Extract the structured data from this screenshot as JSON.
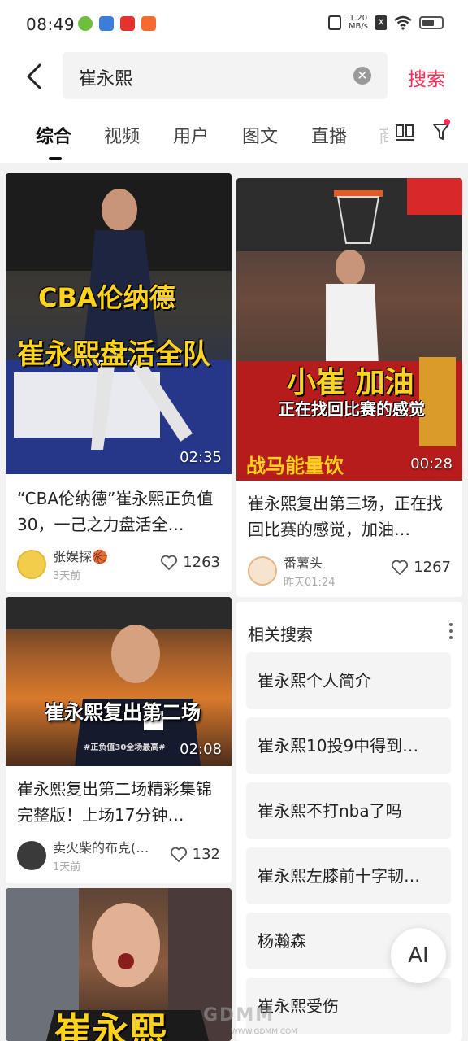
{
  "status_bar": {
    "time": "08:49",
    "net_speed_top": "1.20",
    "net_speed_bottom": "MB/s",
    "x_label": "X"
  },
  "search": {
    "query": "崔永熙",
    "button_label": "搜索"
  },
  "tabs": [
    "综合",
    "视频",
    "用户",
    "图文",
    "直播"
  ],
  "tab_overflow": "商",
  "cards": [
    {
      "thumb_text_1": "CBA伦纳德",
      "thumb_text_2": "崔永熙盘活全队",
      "duration": "02:35",
      "title": "“CBA伦纳德”崔永熙正负值30，一己之力盘活全…",
      "author": "张娱探🏀",
      "time": "3天前",
      "likes": "1263"
    },
    {
      "thumb_text_1": "小崔 加油",
      "thumb_text_2": "正在找回比赛的感觉",
      "thumb_text_3": "战马能量饮",
      "duration": "00:28",
      "title": "崔永熙复出第三场，正在找回比赛的感觉，加油…",
      "author": "番薯头",
      "time": "昨天01:24",
      "likes": "1267"
    },
    {
      "thumb_text_1": "崔永熙复出第二场",
      "thumb_text_2": "#正负值30全场最高#",
      "duration": "02:08",
      "title": "崔永熙复出第二场精彩集锦完整版！上场17分钟…",
      "author": "卖火柴的布克(…",
      "time": "1天前",
      "likes": "132"
    },
    {
      "thumb_text_1": "崔永熙"
    }
  ],
  "related": {
    "title": "相关搜索",
    "items": [
      "崔永熙个人简介",
      "崔永熙10投9中得到…",
      "崔永熙不打nba了吗",
      "崔永熙左膝前十字韧…",
      "杨瀚森",
      "崔永熙受伤"
    ]
  },
  "ai_label": "AI",
  "watermark": {
    "main": "GDMM",
    "sub": "WWW.GDMM.COM"
  },
  "colors": {
    "accent": "#fe2c55",
    "page_bg": "#f2f2f2"
  }
}
